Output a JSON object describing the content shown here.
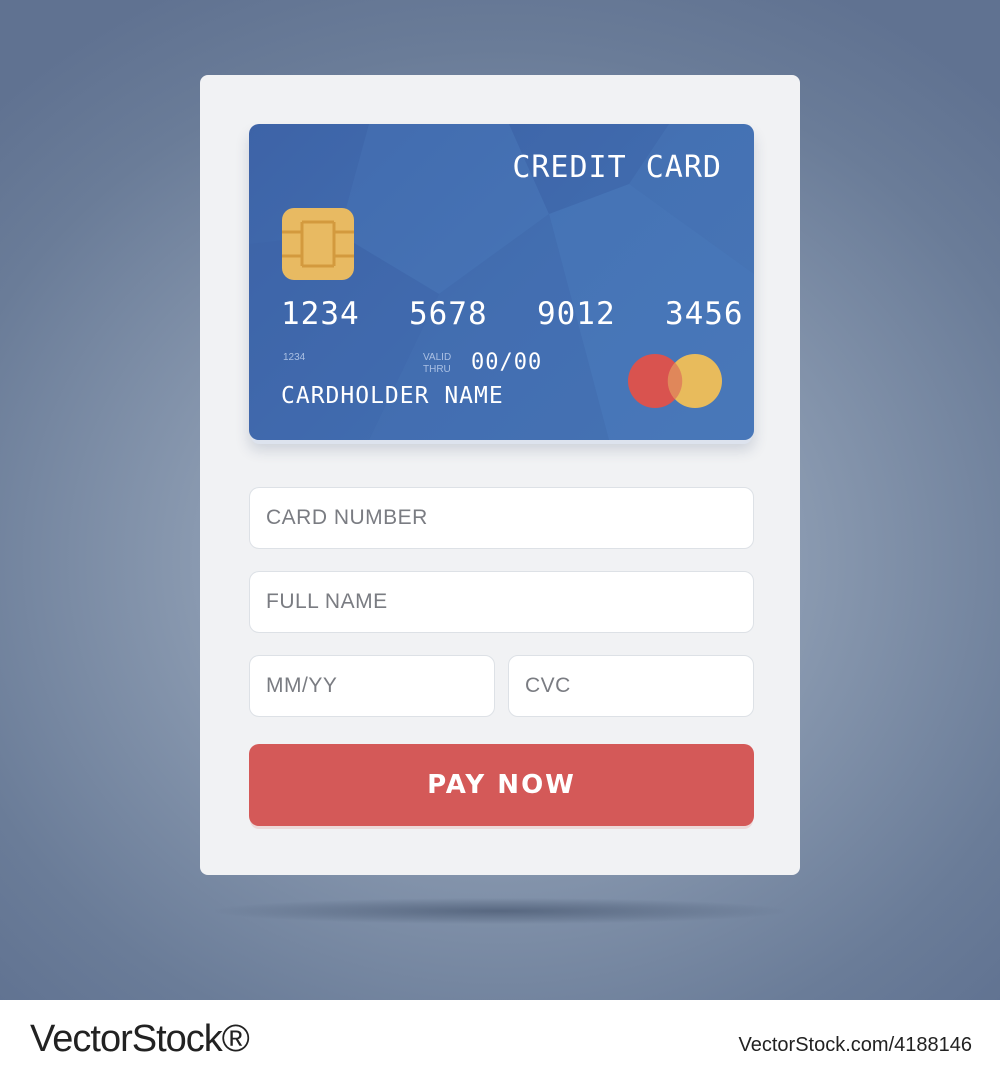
{
  "colors": {
    "background": "#8797ae",
    "panel": "#f1f2f4",
    "card": "#4471b3",
    "chip": "#e8ba62",
    "pay_button": "#d45958",
    "logo_red": "#d9534f",
    "logo_gold": "#e8bb5c"
  },
  "card": {
    "title": "CREDIT CARD",
    "chip_icon": "chip-icon",
    "number": "1234  5678  9012  3456",
    "small_number": "1234",
    "valid_thru": "VALID THRU",
    "expiry": "00/00",
    "holder": "CARDHOLDER NAME",
    "brand_icon": "two-circles-card-brand-logo"
  },
  "form": {
    "card_number_placeholder": "CARD NUMBER",
    "full_name_placeholder": "FULL NAME",
    "expiry_placeholder": "MM/YY",
    "cvc_placeholder": "CVC",
    "pay_label": "PAY NOW"
  },
  "footer": {
    "brand": "VectorStock®",
    "image_id": "VectorStock.com/4188146"
  }
}
